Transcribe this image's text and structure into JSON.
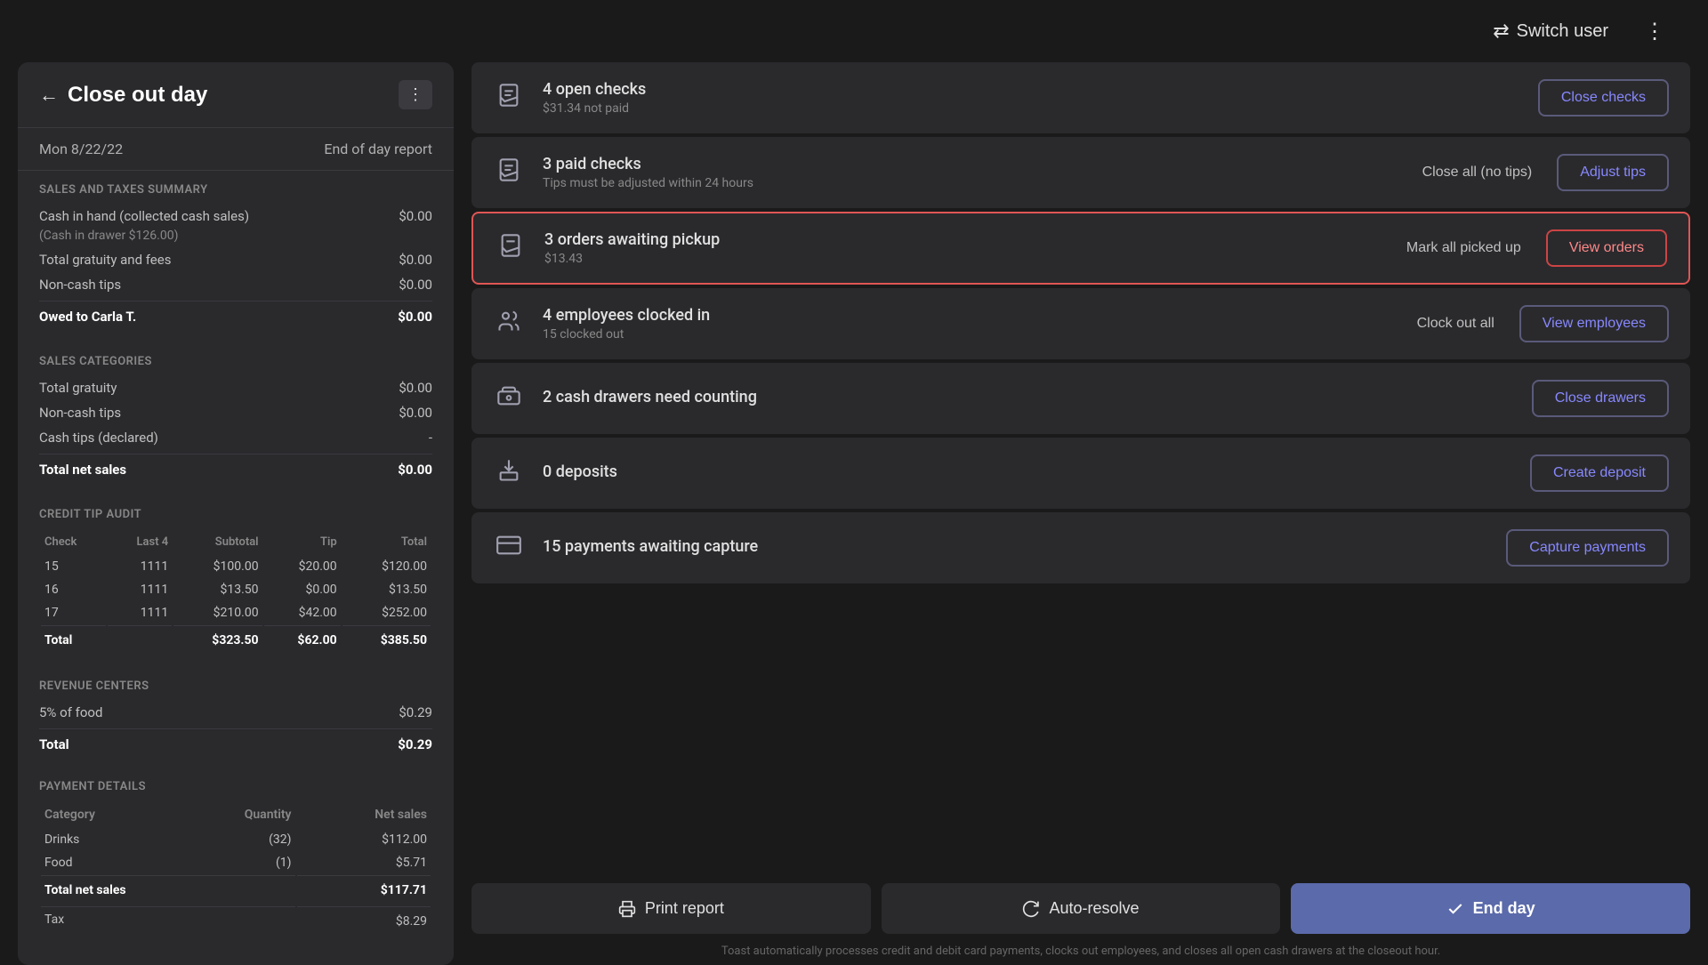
{
  "topbar": {
    "switch_user_label": "Switch user",
    "more_icon": "⋮"
  },
  "left_panel": {
    "back_icon": "←",
    "title": "Close out day",
    "menu_dots": "⋮",
    "date": "Mon 8/22/22",
    "end_of_day_report": "End of day report",
    "sections": {
      "sales_taxes": {
        "header": "SALES AND TAXES SUMMARY",
        "rows": [
          {
            "label": "Cash in hand (collected cash sales)",
            "value": "$0.00"
          },
          {
            "label": "(Cash in drawer $126.00)",
            "value": "",
            "sub": true
          },
          {
            "label": "Total gratuity and fees",
            "value": "$0.00"
          },
          {
            "label": "Non-cash tips",
            "value": "$0.00"
          },
          {
            "label": "Owed to Carla T.",
            "value": "$0.00",
            "bold": true
          }
        ]
      },
      "sales_categories": {
        "header": "SALES CATEGORIES",
        "rows": [
          {
            "label": "Total gratuity",
            "value": "$0.00"
          },
          {
            "label": "Non-cash tips",
            "value": "$0.00"
          },
          {
            "label": "Cash tips (declared)",
            "value": "-"
          },
          {
            "label": "Total net sales",
            "value": "$0.00",
            "bold": true
          }
        ]
      },
      "credit_tip_audit": {
        "header": "CREDIT TIP AUDIT",
        "columns": [
          "Check",
          "Last 4",
          "Subtotal",
          "Tip",
          "Total"
        ],
        "rows": [
          {
            "check": "15",
            "last4": "1111",
            "subtotal": "$100.00",
            "tip": "$20.00",
            "total": "$120.00"
          },
          {
            "check": "16",
            "last4": "1111",
            "subtotal": "$13.50",
            "tip": "$0.00",
            "total": "$13.50"
          },
          {
            "check": "17",
            "last4": "1111",
            "subtotal": "$210.00",
            "tip": "$42.00",
            "total": "$252.00"
          }
        ],
        "total": {
          "label": "Total",
          "subtotal": "$323.50",
          "tip": "$62.00",
          "total": "$385.50"
        }
      },
      "revenue_centers": {
        "header": "REVENUE CENTERS",
        "rows": [
          {
            "label": "5% of food",
            "value": "$0.29"
          }
        ],
        "total": {
          "label": "Total",
          "value": "$0.29"
        }
      },
      "payment_details": {
        "header": "PAYMENT DETAILS",
        "columns": [
          "Category",
          "Quantity",
          "Net sales"
        ],
        "rows": [
          {
            "category": "Drinks",
            "quantity": "(32)",
            "net_sales": "$112.00"
          },
          {
            "category": "Food",
            "quantity": "(1)",
            "net_sales": "$5.71"
          }
        ],
        "total": {
          "label": "Total net sales",
          "value": "$117.71"
        },
        "tax": {
          "label": "Tax",
          "value": "$8.29"
        }
      }
    }
  },
  "right_panel": {
    "items": [
      {
        "id": "open-checks",
        "icon": "receipt",
        "title": "4 open checks",
        "subtitle": "$31.34 not paid",
        "buttons": [
          {
            "id": "close-checks-btn",
            "label": "Close checks",
            "style": "outline",
            "highlighted": false
          }
        ],
        "highlighted": false
      },
      {
        "id": "paid-checks",
        "icon": "receipt",
        "title": "3 paid checks",
        "subtitle": "Tips must be adjusted within 24 hours",
        "buttons": [
          {
            "id": "close-all-no-tips-btn",
            "label": "Close all (no tips)",
            "style": "ghost"
          },
          {
            "id": "adjust-tips-btn",
            "label": "Adjust tips",
            "style": "outline"
          }
        ],
        "highlighted": false
      },
      {
        "id": "orders-awaiting",
        "icon": "receipt",
        "title": "3 orders awaiting pickup",
        "subtitle": "$13.43",
        "buttons": [
          {
            "id": "mark-all-picked-btn",
            "label": "Mark all picked up",
            "style": "ghost"
          },
          {
            "id": "view-orders-btn",
            "label": "View orders",
            "style": "outline"
          }
        ],
        "highlighted": true
      },
      {
        "id": "employees-clocked",
        "icon": "people",
        "title": "4 employees clocked in",
        "subtitle": "15 clocked out",
        "buttons": [
          {
            "id": "clock-out-all-btn",
            "label": "Clock out all",
            "style": "ghost"
          },
          {
            "id": "view-employees-btn",
            "label": "View employees",
            "style": "outline"
          }
        ],
        "highlighted": false
      },
      {
        "id": "cash-drawers",
        "icon": "cash",
        "title": "2 cash drawers need counting",
        "subtitle": "",
        "buttons": [
          {
            "id": "close-drawers-btn",
            "label": "Close drawers",
            "style": "outline"
          }
        ],
        "highlighted": false
      },
      {
        "id": "deposits",
        "icon": "deposit",
        "title": "0 deposits",
        "subtitle": "",
        "buttons": [
          {
            "id": "create-deposit-btn",
            "label": "Create deposit",
            "style": "outline"
          }
        ],
        "highlighted": false
      },
      {
        "id": "payments-capture",
        "icon": "card",
        "title": "15 payments awaiting capture",
        "subtitle": "",
        "buttons": [
          {
            "id": "capture-payments-btn",
            "label": "Capture payments",
            "style": "outline"
          }
        ],
        "highlighted": false
      }
    ],
    "bottom_buttons": {
      "print_report": "Print report",
      "auto_resolve": "Auto-resolve",
      "end_day": "End day"
    },
    "bottom_note": "Toast automatically processes credit and debit card payments, clocks out employees, and closes all open cash drawers at the closeout hour."
  }
}
